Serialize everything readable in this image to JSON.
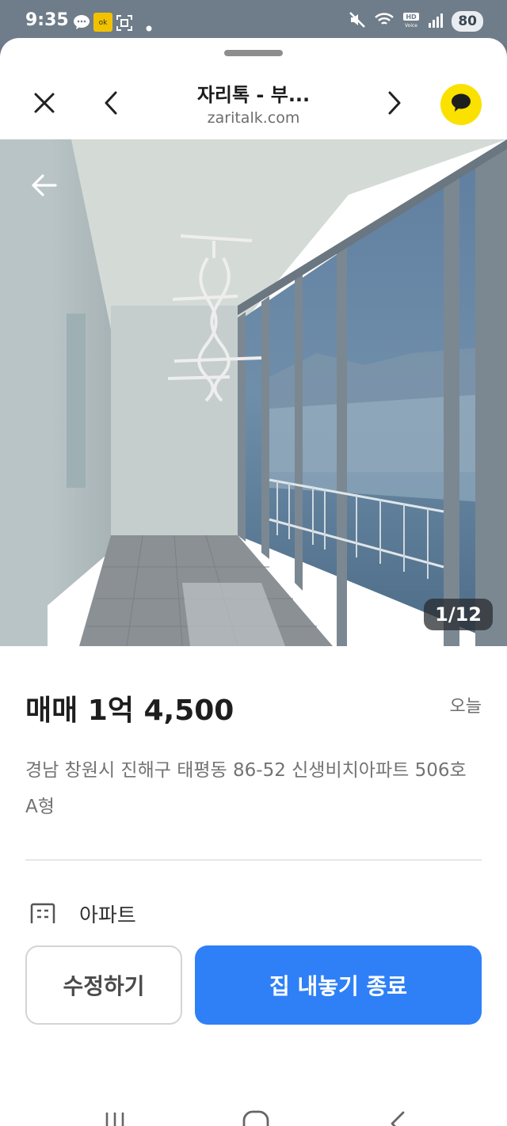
{
  "status_bar": {
    "time": "9:35",
    "battery": "80",
    "icons": [
      "chat-bubble-icon",
      "app-badge-icon",
      "screenshot-icon",
      "dot-icon",
      "mute-icon",
      "wifi-icon",
      "hd-voice-icon",
      "signal-icon",
      "battery-icon"
    ]
  },
  "browser": {
    "title": "자리톡 - 부...",
    "domain": "zaritalk.com",
    "icons": [
      "close-icon",
      "back-chevron-icon",
      "forward-chevron-icon",
      "kakao-talk-icon"
    ]
  },
  "gallery": {
    "counter": "1/12",
    "back_icon": "arrow-left-icon"
  },
  "listing": {
    "price": "매매 1억 4,500",
    "posted": "오늘",
    "address": "경남 창원시 진해구 태평동 86-52 신생비치아파트 506호 A형",
    "property_type": "아파트",
    "type_icon": "building-icon"
  },
  "actions": {
    "edit_label": "수정하기",
    "end_label": "집 내놓기 종료"
  },
  "nav": {
    "icons": [
      "recent-apps-icon",
      "home-icon",
      "back-icon"
    ]
  },
  "colors": {
    "accent": "#2f80f7",
    "kakao": "#fae100",
    "status_bar": "#6f7d8a"
  }
}
